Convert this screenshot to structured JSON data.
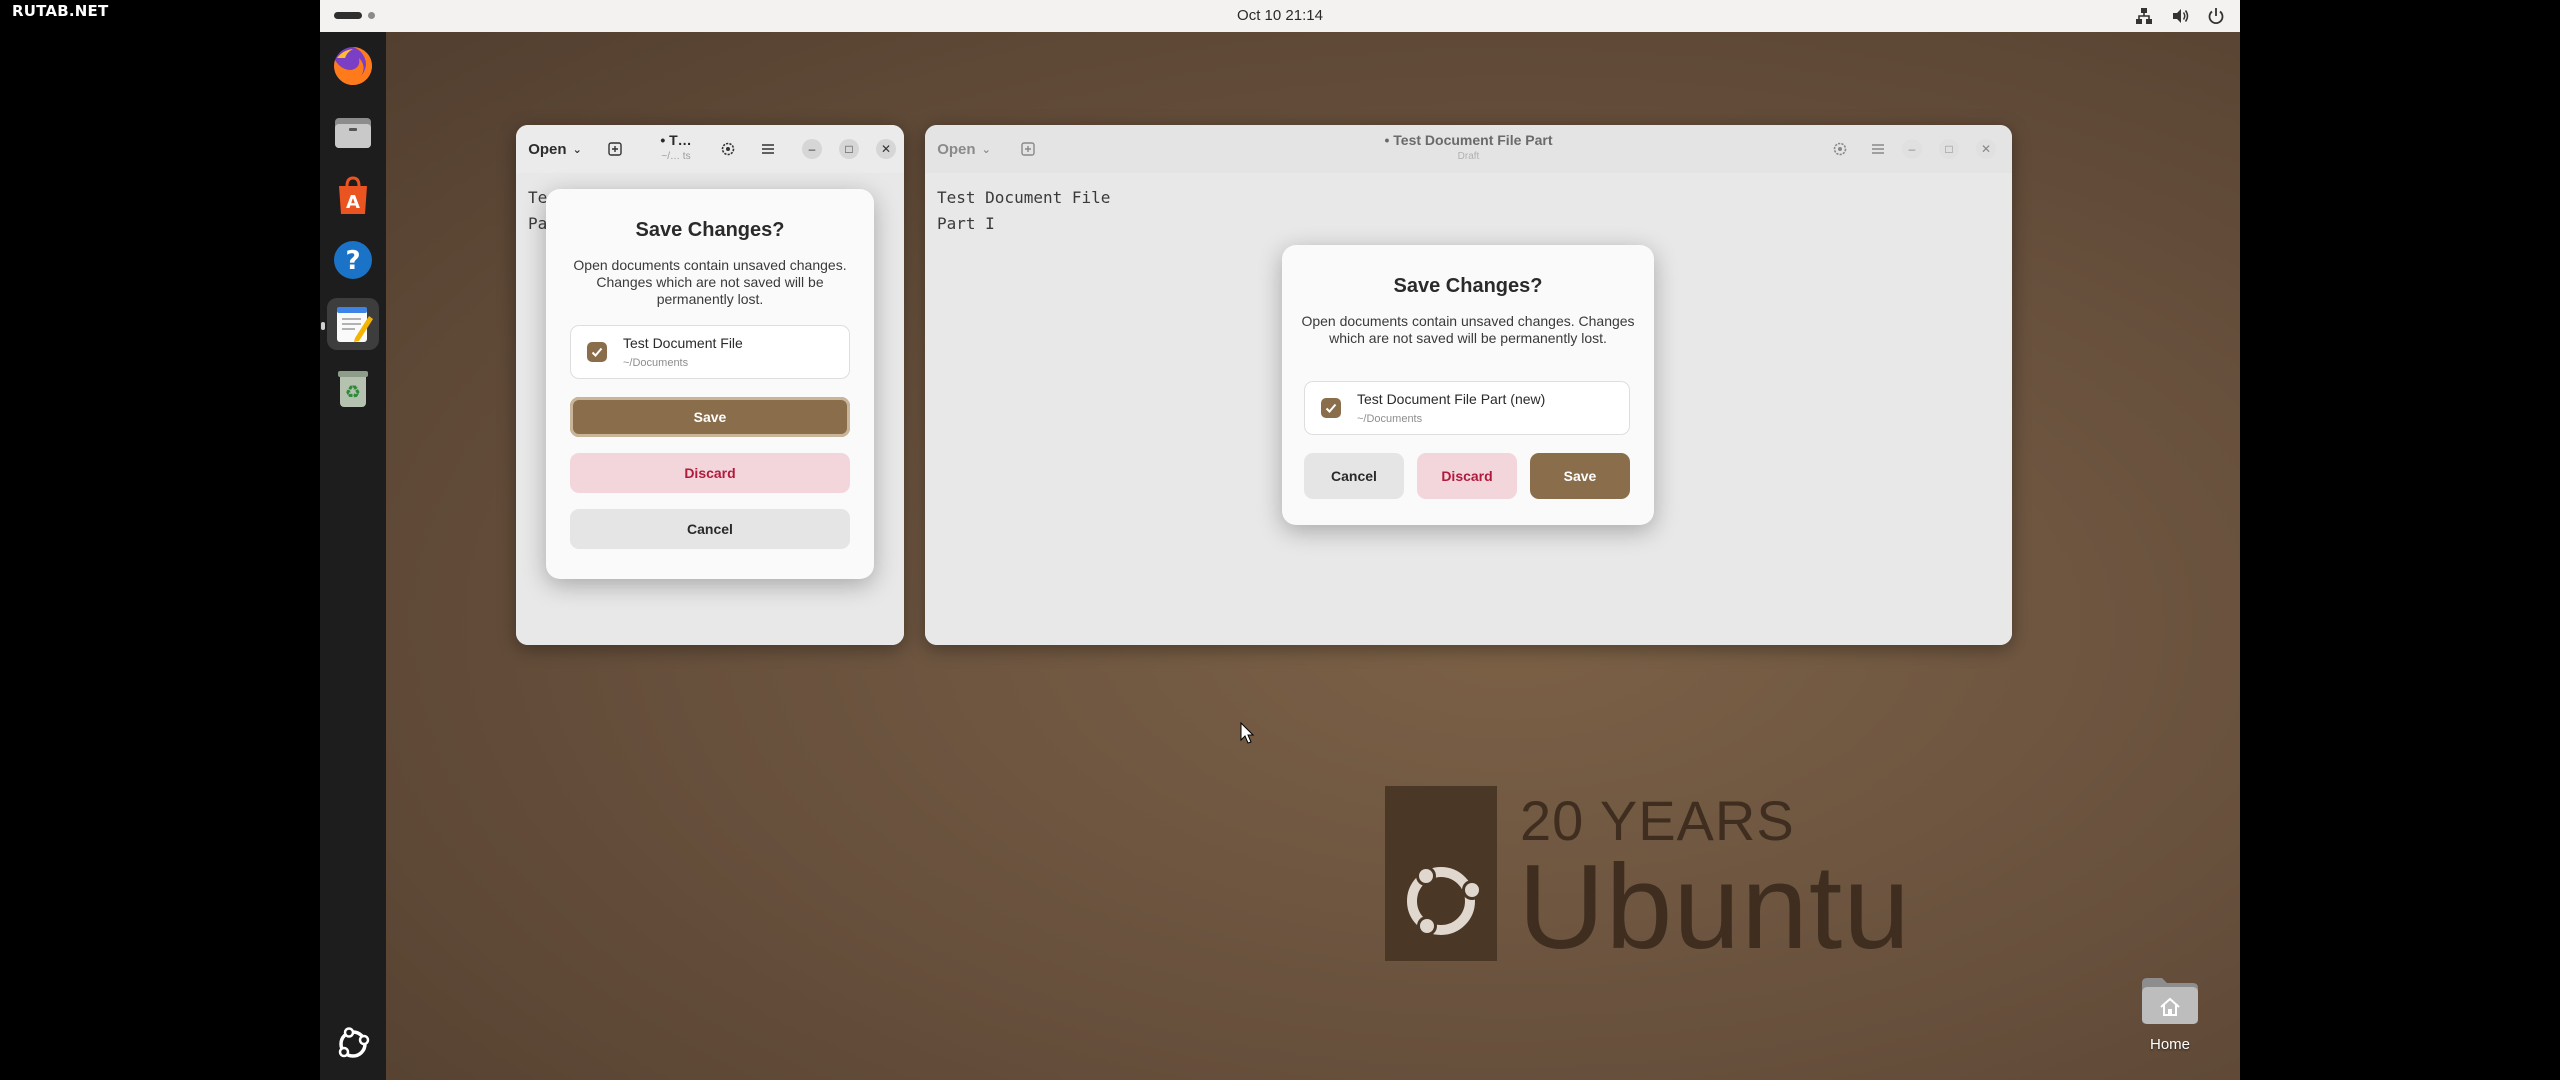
{
  "watermark": "RUTAB.NET",
  "topbar": {
    "clock": "Oct 10  21:14"
  },
  "dock": {
    "items": [
      "firefox-icon",
      "files-icon",
      "app-center-icon",
      "help-icon",
      "text-editor-icon",
      "trash-icon"
    ],
    "show_apps": "show-apps-icon"
  },
  "left_window": {
    "open_label": "Open",
    "title": "• T…",
    "subtitle": "~/… ts",
    "body_lines": [
      "Te",
      "Pa"
    ],
    "dialog": {
      "title": "Save Changes?",
      "message": "Open documents contain unsaved changes. Changes which are not saved will be permanently lost.",
      "file_name": "Test Document File",
      "file_path": "~/Documents",
      "save": "Save",
      "discard": "Discard",
      "cancel": "Cancel"
    }
  },
  "right_window": {
    "open_label": "Open",
    "title": "• Test Document File Part",
    "subtitle": "Draft",
    "body_lines": [
      "Test Document File",
      "Part I"
    ],
    "dialog": {
      "title": "Save Changes?",
      "message": "Open documents contain unsaved changes. Changes which are not saved will be permanently lost.",
      "file_name": "Test Document File Part (new)",
      "file_path": "~/Documents",
      "cancel": "Cancel",
      "discard": "Discard",
      "save": "Save"
    }
  },
  "branding": {
    "years": "20 YEARS",
    "name": "Ubuntu"
  },
  "desktop_icon": {
    "label": "Home"
  },
  "colors": {
    "accent": "#8a6d4b",
    "discard_bg": "#f3d6dc",
    "discard_text": "#b01b3c",
    "topbar": "#f4f2f0",
    "dock": "#1d1d1d"
  }
}
